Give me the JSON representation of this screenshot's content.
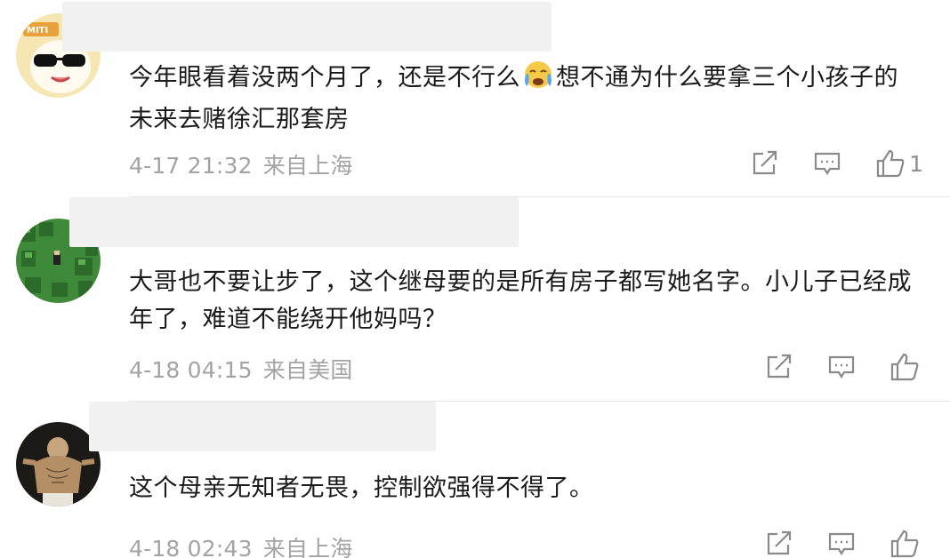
{
  "comments": [
    {
      "text_part1": "今年眼看着没两个月了，还是不行么",
      "emoji": "crying-face",
      "text_part2": "想不通为什么要拿三个小孩子的未来去赌徐汇那套房",
      "date": "4-17 21:32",
      "location": "来自上海",
      "likes": "1",
      "avatar": "sunglasses-cat-avatar"
    },
    {
      "text": "大哥也不要让步了，这个继母要的是所有房子都写她名字。小儿子已经成年了，难道不能绕开他妈吗？",
      "date": "4-18 04:15",
      "location": "来自美国",
      "likes": "",
      "avatar": "pixel-forest-avatar"
    },
    {
      "text": "这个母亲无知者无畏，控制欲强得不得了。",
      "date": "4-18 02:43",
      "location": "来自上海",
      "likes": "",
      "avatar": "dark-figure-avatar"
    }
  ],
  "colors": {
    "text": "#1a1a1a",
    "meta": "#a3a3a3",
    "icon": "#8a8a8a",
    "divider": "#e6e6e6",
    "name_placeholder": "#f1f1f1"
  }
}
